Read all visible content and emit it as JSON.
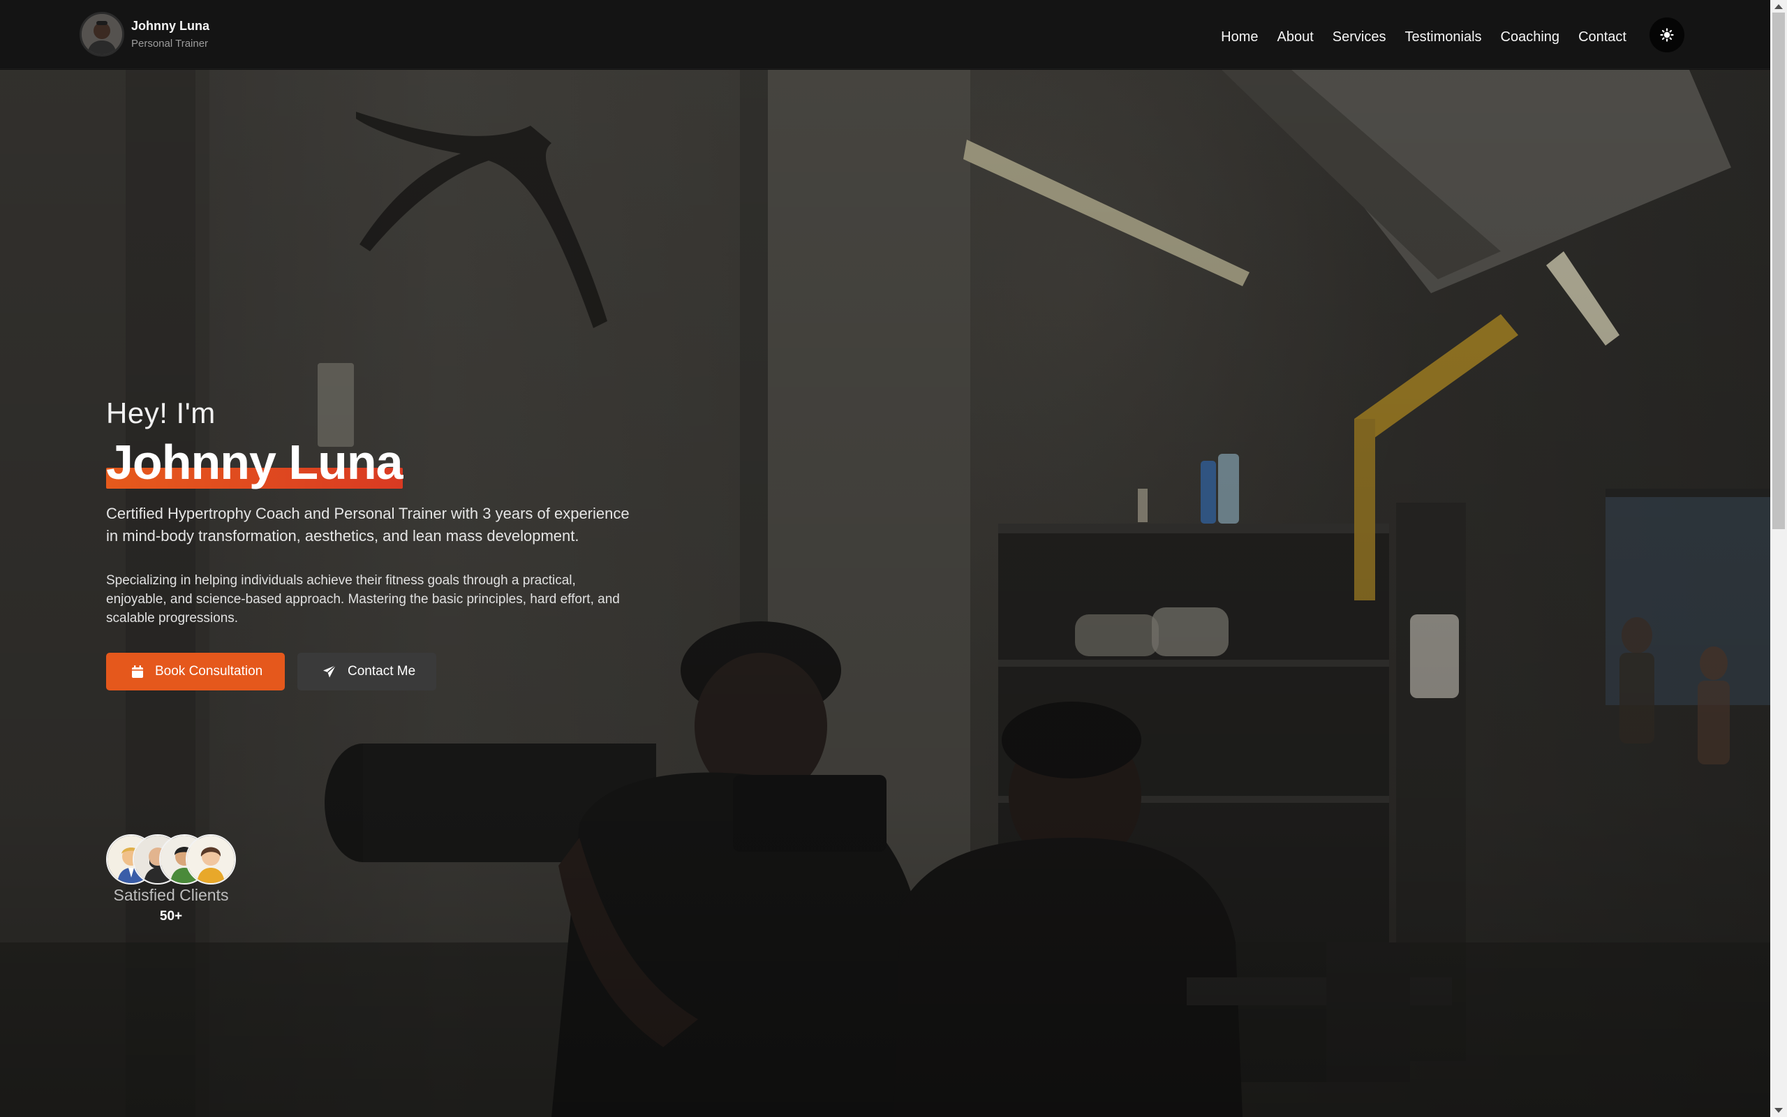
{
  "brand": {
    "name": "Johnny Luna",
    "role": "Personal Trainer"
  },
  "nav": {
    "items": [
      "Home",
      "About",
      "Services",
      "Testimonials",
      "Coaching",
      "Contact"
    ]
  },
  "hero": {
    "greeting": "Hey! I'm",
    "name": "Johnny Luna",
    "lead": "Certified Hypertrophy Coach and Personal Trainer with 3 years of experience in mind-body transformation, aesthetics, and lean mass development.",
    "sub": "Specializing in helping individuals achieve their fitness goals through a practical, enjoyable, and science-based approach. Mastering the basic principles, hard effort, and scalable progressions.",
    "primary_button": "Book Consultation",
    "secondary_button": "Contact Me"
  },
  "clients": {
    "label": "Satisfied Clients",
    "count": "50+"
  },
  "colors": {
    "accent": "#e5581c",
    "nav_bg": "#141414",
    "secondary_button": "#3a3a3a"
  },
  "icons": {
    "theme_toggle": "sun-icon",
    "primary_button": "calendar-icon",
    "secondary_button": "paper-plane-icon"
  }
}
